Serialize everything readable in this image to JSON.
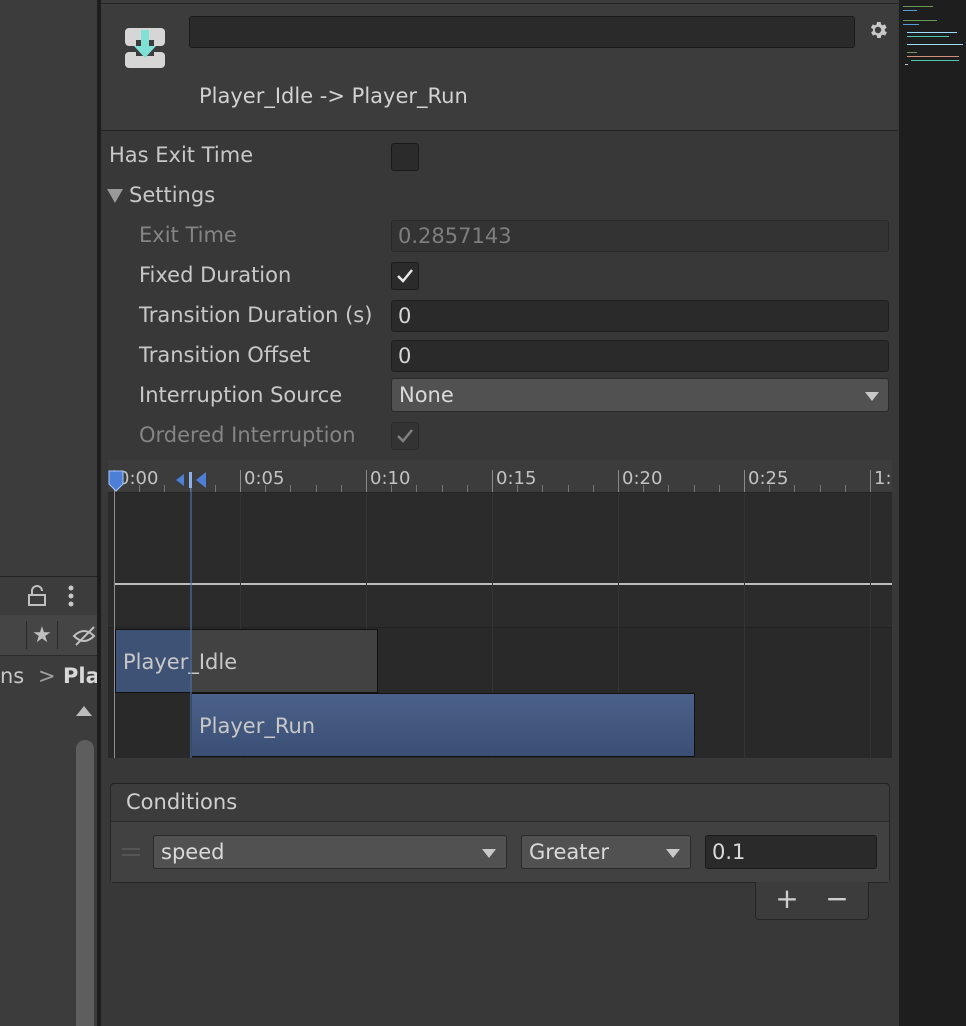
{
  "left_panel": {
    "breadcrumb_start": "ns",
    "breadcrumb_separator": ">",
    "breadcrumb_end": "Pla"
  },
  "inspector": {
    "transition_name_value": "",
    "title": "Player_Idle -> Player_Run",
    "has_exit_time": {
      "label": "Has Exit Time",
      "checked": false
    },
    "settings": {
      "label": "Settings",
      "expanded": true,
      "exit_time": {
        "label": "Exit Time",
        "value": "0.2857143",
        "enabled": false
      },
      "fixed_duration": {
        "label": "Fixed Duration",
        "checked": true
      },
      "transition_duration": {
        "label": "Transition Duration (s)",
        "value": "0"
      },
      "transition_offset": {
        "label": "Transition Offset",
        "value": "0"
      },
      "interruption_source": {
        "label": "Interruption Source",
        "value": "None"
      },
      "ordered_interruption": {
        "label": "Ordered Interruption",
        "checked": true,
        "enabled": false
      }
    }
  },
  "timeline": {
    "ticks": [
      "0:00",
      "0:05",
      "0:10",
      "0:15",
      "0:20",
      "0:25",
      "1:"
    ],
    "source_state": "Player_Idle",
    "destination_state": "Player_Run"
  },
  "conditions": {
    "title": "Conditions",
    "items": [
      {
        "parameter": "speed",
        "mode": "Greater",
        "threshold": "0.1"
      }
    ],
    "add_label": "+",
    "remove_label": "−"
  },
  "colors": {
    "background": "#383838",
    "header": "#3c3c3c",
    "field": "#2a2a2a",
    "transition_bar": "#4a618a",
    "accent_icon": "#7fe0d6"
  },
  "icons": {
    "transition": "transition-icon",
    "settings": "gear-icon",
    "lock": "lock-icon",
    "menu": "kebab-icon",
    "favorite": "star-icon",
    "visibility": "eye-off-icon"
  }
}
